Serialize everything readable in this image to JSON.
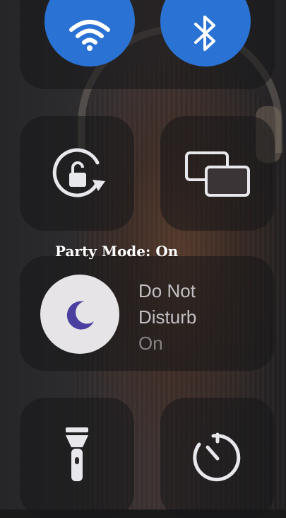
{
  "overlay": {
    "party_mode": "Party Mode: On"
  },
  "dnd": {
    "line1": "Do Not",
    "line2": "Disturb",
    "status": "On"
  },
  "icons": {
    "wifi": "wifi-icon",
    "bluetooth": "bluetooth-icon",
    "rotation_lock": "rotation-lock-icon",
    "screen_mirroring": "screen-mirroring-icon",
    "moon": "moon-icon",
    "flashlight": "flashlight-icon",
    "timer": "timer-icon"
  },
  "colors": {
    "accent_blue": "#2a72d4",
    "moon": "#4b3fa0"
  }
}
